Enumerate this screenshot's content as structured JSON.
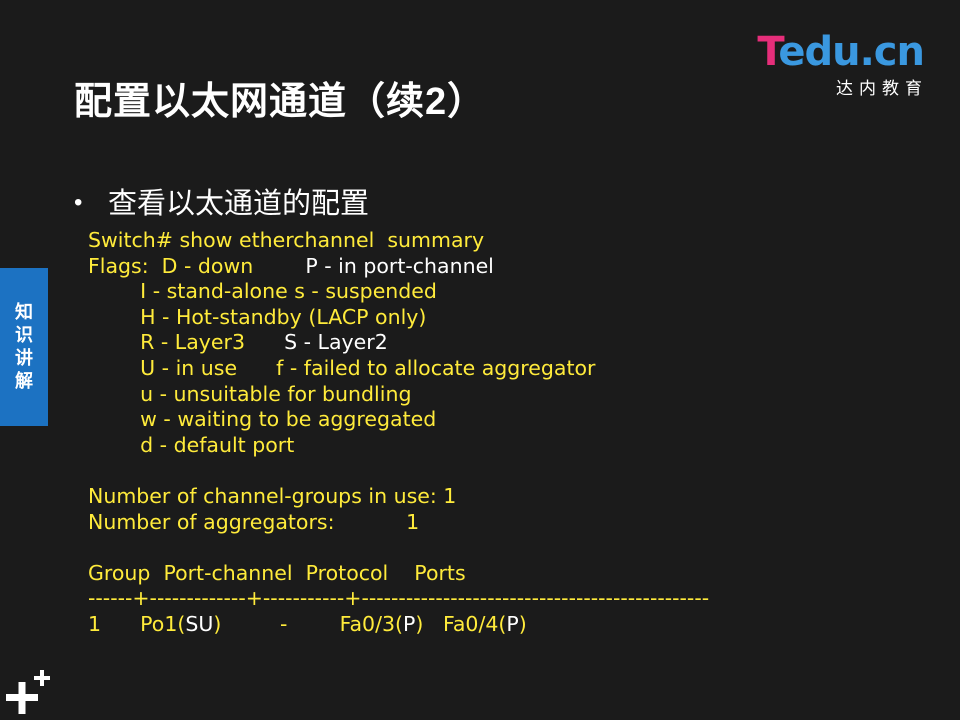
{
  "title": "配置以太网通道（续2）",
  "logo": {
    "word_t": "T",
    "word_rest": "edu.cn",
    "subtitle": "达内教育"
  },
  "bullet": "查看以太通道的配置",
  "side_tab": [
    "知",
    "识",
    "讲",
    "解"
  ],
  "code": {
    "line1": "Switch# show etherchannel  summary",
    "line2a": "Flags:  D - down        ",
    "line2b": "P - in port-channel",
    "line3": "        I - stand-alone s - suspended",
    "line4": "        H - Hot-standby (LACP only)",
    "line5a": "        R - Layer3      ",
    "line5b": "S - Layer2",
    "line6a": "        U - in use      ",
    "line6b": "f - failed to allocate aggregator",
    "line7": "        u - unsuitable for bundling",
    "line8": "        w - waiting to be aggregated",
    "line9": "        d - default port",
    "line10": "Number of channel-groups in use: 1",
    "line11": "Number of aggregators:           1",
    "line12": "Group  Port-channel  Protocol    Ports",
    "line13": "------+-------------+-----------+-----------------------------------------------",
    "line14a": "1      Po1(",
    "line14b": "SU",
    "line14c": ")         -        Fa0/3(",
    "line14d": "P",
    "line14e": ")   Fa0/4(",
    "line14f": "P",
    "line14g": ")"
  },
  "colors": {
    "background": "#1b1b1b",
    "code_text": "#ffeb3b",
    "accent_blue": "#1c72c2",
    "logo_pink": "#e62e7a",
    "logo_blue": "#3a98e0"
  },
  "icons": [
    "plus-icon"
  ]
}
